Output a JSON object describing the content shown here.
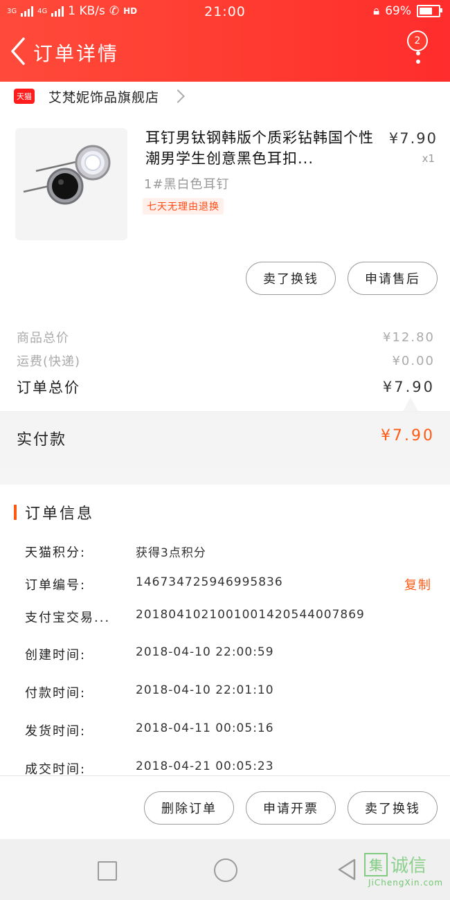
{
  "status_bar": {
    "net1": "3G",
    "net2": "4G",
    "speed": "1 KB/s",
    "hd": "HD",
    "time": "21:00",
    "battery": "69%",
    "battery_level": 0.69
  },
  "header": {
    "title": "订单详情",
    "badge": "2"
  },
  "store": {
    "badge": "天猫",
    "name": "艾梵妮饰品旗舰店"
  },
  "product": {
    "title": "耳钉男钛钢韩版个质彩钻韩国个性潮男学生创意黑色耳扣...",
    "sku": "1#黑白色耳钉",
    "tag": "七天无理由退换",
    "price": "¥7.90",
    "qty": "x1"
  },
  "product_buttons": {
    "sell": "卖了换钱",
    "after_sale": "申请售后"
  },
  "summary": {
    "goods_label": "商品总价",
    "goods_value": "¥12.80",
    "shipping_label": "运费(快递)",
    "shipping_value": "¥0.00",
    "total_label": "订单总价",
    "total_value": "¥7.90",
    "paid_label": "实付款",
    "paid_value": "¥7.90"
  },
  "order_info": {
    "title": "订单信息",
    "rows": [
      {
        "label": "天猫积分:",
        "value": "获得3点积分"
      },
      {
        "label": "订单编号:",
        "value": "146734725946995836"
      },
      {
        "label": "支付宝交易...",
        "value": "2018041021001001420544007869"
      },
      {
        "label": "创建时间:",
        "value": "2018-04-10 22:00:59"
      },
      {
        "label": "付款时间:",
        "value": "2018-04-10 22:01:10"
      },
      {
        "label": "发货时间:",
        "value": "2018-04-11 00:05:16"
      },
      {
        "label": "成交时间:",
        "value": "2018-04-21 00:05:23"
      }
    ],
    "copy": "复制"
  },
  "bottom_actions": {
    "delete": "删除订单",
    "invoice": "申请开票",
    "sell": "卖了换钱"
  },
  "watermark": {
    "box": "集",
    "text": "诚信",
    "url": "JiChengXin.com"
  },
  "colors": {
    "header": "#ff3b30",
    "accent": "#ff5a14"
  }
}
